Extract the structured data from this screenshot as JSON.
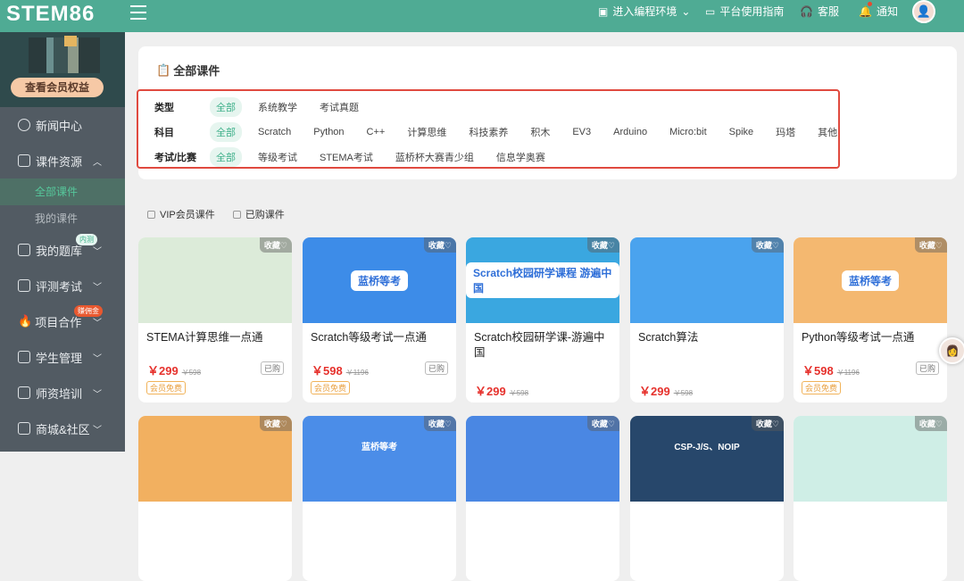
{
  "header": {
    "logo": "STEM86",
    "nav": [
      {
        "label": "进入编程环境",
        "icon": "terminal-icon"
      },
      {
        "label": "平台使用指南",
        "icon": "monitor-icon"
      },
      {
        "label": "客服",
        "icon": "headset-icon"
      },
      {
        "label": "通知",
        "icon": "bell-icon"
      }
    ]
  },
  "sidebar": {
    "vip_button": "查看会员权益",
    "items": [
      {
        "label": "新闻中心"
      },
      {
        "label": "课件资源"
      },
      {
        "label": "我的题库",
        "badge": "内测"
      },
      {
        "label": "评测考试"
      },
      {
        "label": "项目合作",
        "badge": "赚佣金"
      },
      {
        "label": "学生管理"
      },
      {
        "label": "师资培训"
      },
      {
        "label": "商城&社区"
      }
    ],
    "sub": [
      "全部课件",
      "我的课件"
    ]
  },
  "filter": {
    "title": "全部课件",
    "rows": [
      {
        "label": "类型",
        "options": [
          "全部",
          "系统教学",
          "考试真题"
        ]
      },
      {
        "label": "科目",
        "options": [
          "全部",
          "Scratch",
          "Python",
          "C++",
          "计算思维",
          "科技素养",
          "积木",
          "EV3",
          "Arduino",
          "Micro:bit",
          "Spike",
          "玛塔",
          "其他"
        ]
      },
      {
        "label": "考试/比赛",
        "options": [
          "全部",
          "等级考试",
          "STEMA考试",
          "蓝桥杯大赛青少组",
          "信息学奥赛"
        ]
      }
    ]
  },
  "checks": [
    "VIP会员课件",
    "已购课件"
  ],
  "fav_label": "收藏♡",
  "courses": [
    {
      "name": "STEMA计算思维一点通",
      "price": "￥299",
      "orig": "￥598",
      "bought": "已购",
      "free": "会员免费",
      "color": "#dcebd9"
    },
    {
      "name": "Scratch等级考试一点通",
      "price": "￥598",
      "orig": "￥1196",
      "bought": "已购",
      "free": "会员免费",
      "color": "#3d8ce8",
      "thumb_text": "蓝桥等考"
    },
    {
      "name": "Scratch校园研学课-游遍中国",
      "price": "￥299",
      "orig": "￥598",
      "color": "#3aa7e0",
      "thumb_text": "Scratch校园研学课程 游遍中国"
    },
    {
      "name": "Scratch算法",
      "price": "￥299",
      "orig": "￥598",
      "color": "#4aa3ee"
    },
    {
      "name": "Python等级考试一点通",
      "price": "￥598",
      "orig": "￥1196",
      "bought": "已购",
      "free": "会员免费",
      "color": "#f4b870",
      "thumb_text": "蓝桥等考"
    }
  ],
  "row2": [
    {
      "color": "#f2b060"
    },
    {
      "color": "#4b8de8",
      "thumb_text": "蓝桥等考"
    },
    {
      "color": "#4a87e3"
    },
    {
      "color": "#27476b",
      "thumb_text": "CSP-J/S、NOIP"
    },
    {
      "color": "#cfeee6"
    }
  ]
}
